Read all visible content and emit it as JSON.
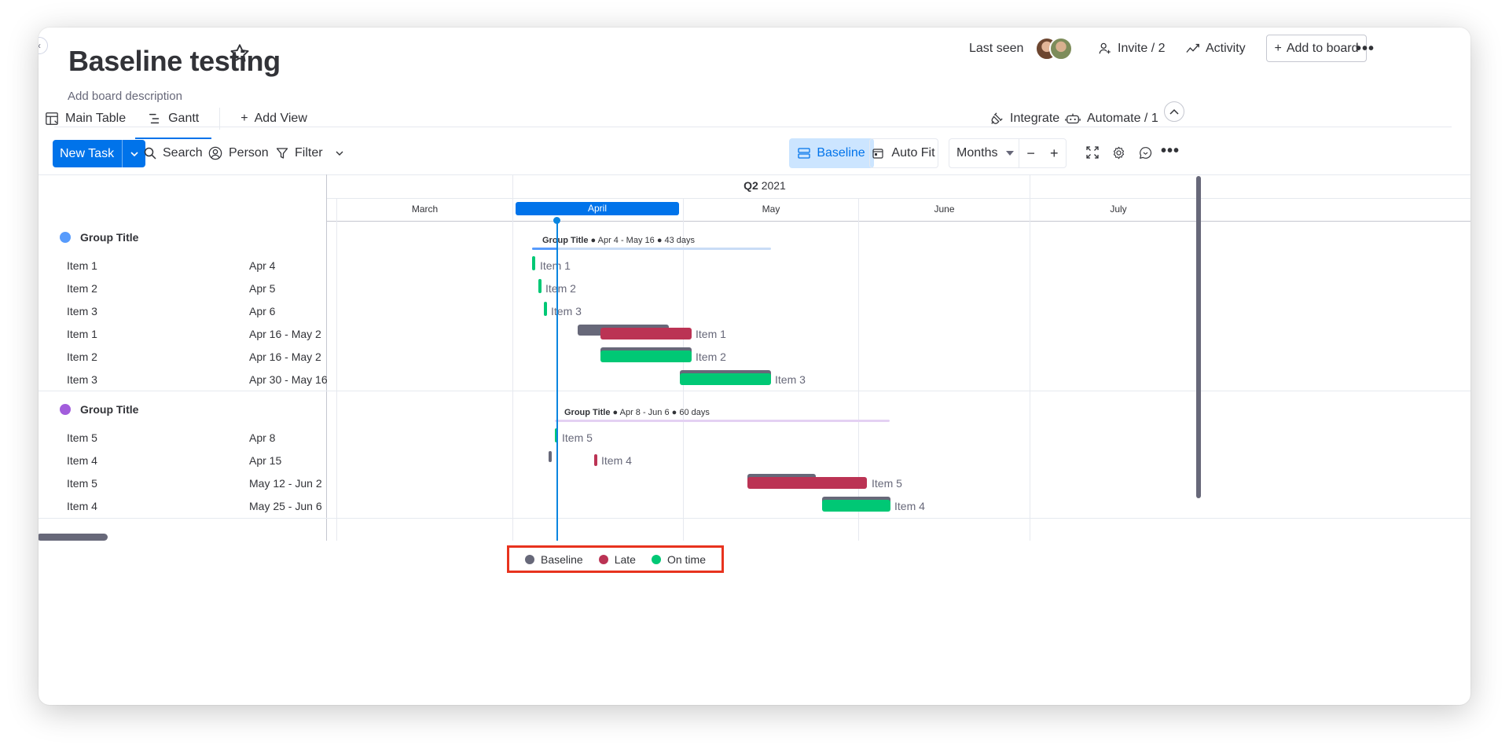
{
  "board": {
    "title": "Baseline testing",
    "description": "Add board description"
  },
  "header": {
    "last_seen": "Last seen",
    "invite": "Invite / 2",
    "activity": "Activity",
    "add_to_board": "Add to board"
  },
  "tabs": [
    {
      "label": "Main Table",
      "icon": "table-icon"
    },
    {
      "label": "Gantt",
      "icon": "gantt-icon",
      "active": true
    },
    {
      "label": "Add View",
      "icon": "plus-icon"
    }
  ],
  "tabs_right": {
    "integrate": "Integrate",
    "automate": "Automate / 1"
  },
  "toolbar": {
    "new_task": "New Task",
    "search": "Search",
    "person": "Person",
    "filter": "Filter",
    "baseline": "Baseline",
    "auto_fit": "Auto Fit",
    "zoom_select": "Months"
  },
  "timeline": {
    "quarter_bold": "Q2",
    "quarter_year": "2021",
    "months": [
      "March",
      "April",
      "May",
      "June",
      "July"
    ],
    "active_month": "April"
  },
  "groups": [
    {
      "title": "Group Title",
      "color": "#579bfc",
      "summary_name": "Group Title",
      "summary_detail": " ● Apr 4 - May 16 ● 43 days",
      "rows": [
        {
          "name": "Item 1",
          "date": "Apr 4",
          "status": "on-time"
        },
        {
          "name": "Item 2",
          "date": "Apr 5",
          "status": "on-time"
        },
        {
          "name": "Item 3",
          "date": "Apr 6",
          "status": "on-time"
        },
        {
          "name": "Item 1",
          "date": "Apr 16 - May 2",
          "status": "late"
        },
        {
          "name": "Item 2",
          "date": "Apr 16 - May 2",
          "status": "on-time"
        },
        {
          "name": "Item 3",
          "date": "Apr 30 - May 16",
          "status": "on-time"
        }
      ]
    },
    {
      "title": "Group Title",
      "color": "#a25ddc",
      "summary_name": "Group Title",
      "summary_detail": " ● Apr 8 - Jun 6 ● 60 days",
      "rows": [
        {
          "name": "Item 5",
          "date": "Apr 8",
          "status": "on-time"
        },
        {
          "name": "Item 4",
          "date": "Apr 15",
          "status": "late"
        },
        {
          "name": "Item 5",
          "date": "May 12 - Jun 2",
          "status": "late"
        },
        {
          "name": "Item 4",
          "date": "May 25 - Jun 6",
          "status": "on-time"
        }
      ]
    }
  ],
  "legend": [
    {
      "label": "Baseline",
      "color": "#676879"
    },
    {
      "label": "Late",
      "color": "#bb3354"
    },
    {
      "label": "On time",
      "color": "#00c875"
    }
  ],
  "colors": {
    "primary": "#0073ea",
    "baseline": "#676879",
    "late": "#bb3354",
    "on_time": "#00c875",
    "legend_highlight": "#e8331e"
  }
}
